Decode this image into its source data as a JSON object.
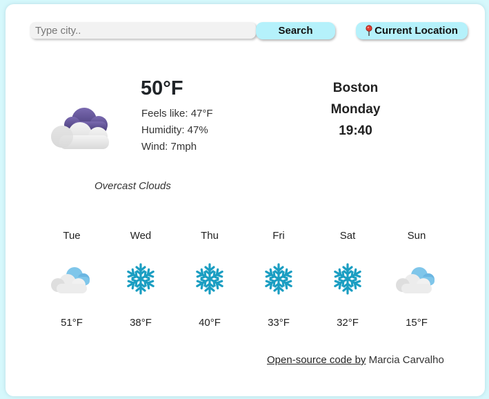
{
  "search": {
    "placeholder": "Type city..",
    "button_label": "Search",
    "location_button_label": "Current Location"
  },
  "current": {
    "temperature": "50°F",
    "feels_like": "Feels like: 47°F",
    "humidity": "Humidity: 47%",
    "wind": "Wind: 7mph",
    "description": "Overcast Clouds",
    "icon": "overcast-clouds-icon",
    "city": "Boston",
    "day": "Monday",
    "time": "19:40"
  },
  "forecast": [
    {
      "day": "Tue",
      "temp": "51°F",
      "icon": "cloudy-icon"
    },
    {
      "day": "Wed",
      "temp": "38°F",
      "icon": "snowflake-icon"
    },
    {
      "day": "Thu",
      "temp": "40°F",
      "icon": "snowflake-icon"
    },
    {
      "day": "Fri",
      "temp": "33°F",
      "icon": "snowflake-icon"
    },
    {
      "day": "Sat",
      "temp": "32°F",
      "icon": "snowflake-icon"
    },
    {
      "day": "Sun",
      "temp": "15°F",
      "icon": "cloudy-icon"
    }
  ],
  "footer": {
    "link_text": "Open-source code",
    "by_text": " by",
    "author": " Marcia Carvalho"
  },
  "colors": {
    "page_background": "#d6f8fc",
    "button_background": "#b5f1fb",
    "snowflake": "#1b9ec2"
  }
}
